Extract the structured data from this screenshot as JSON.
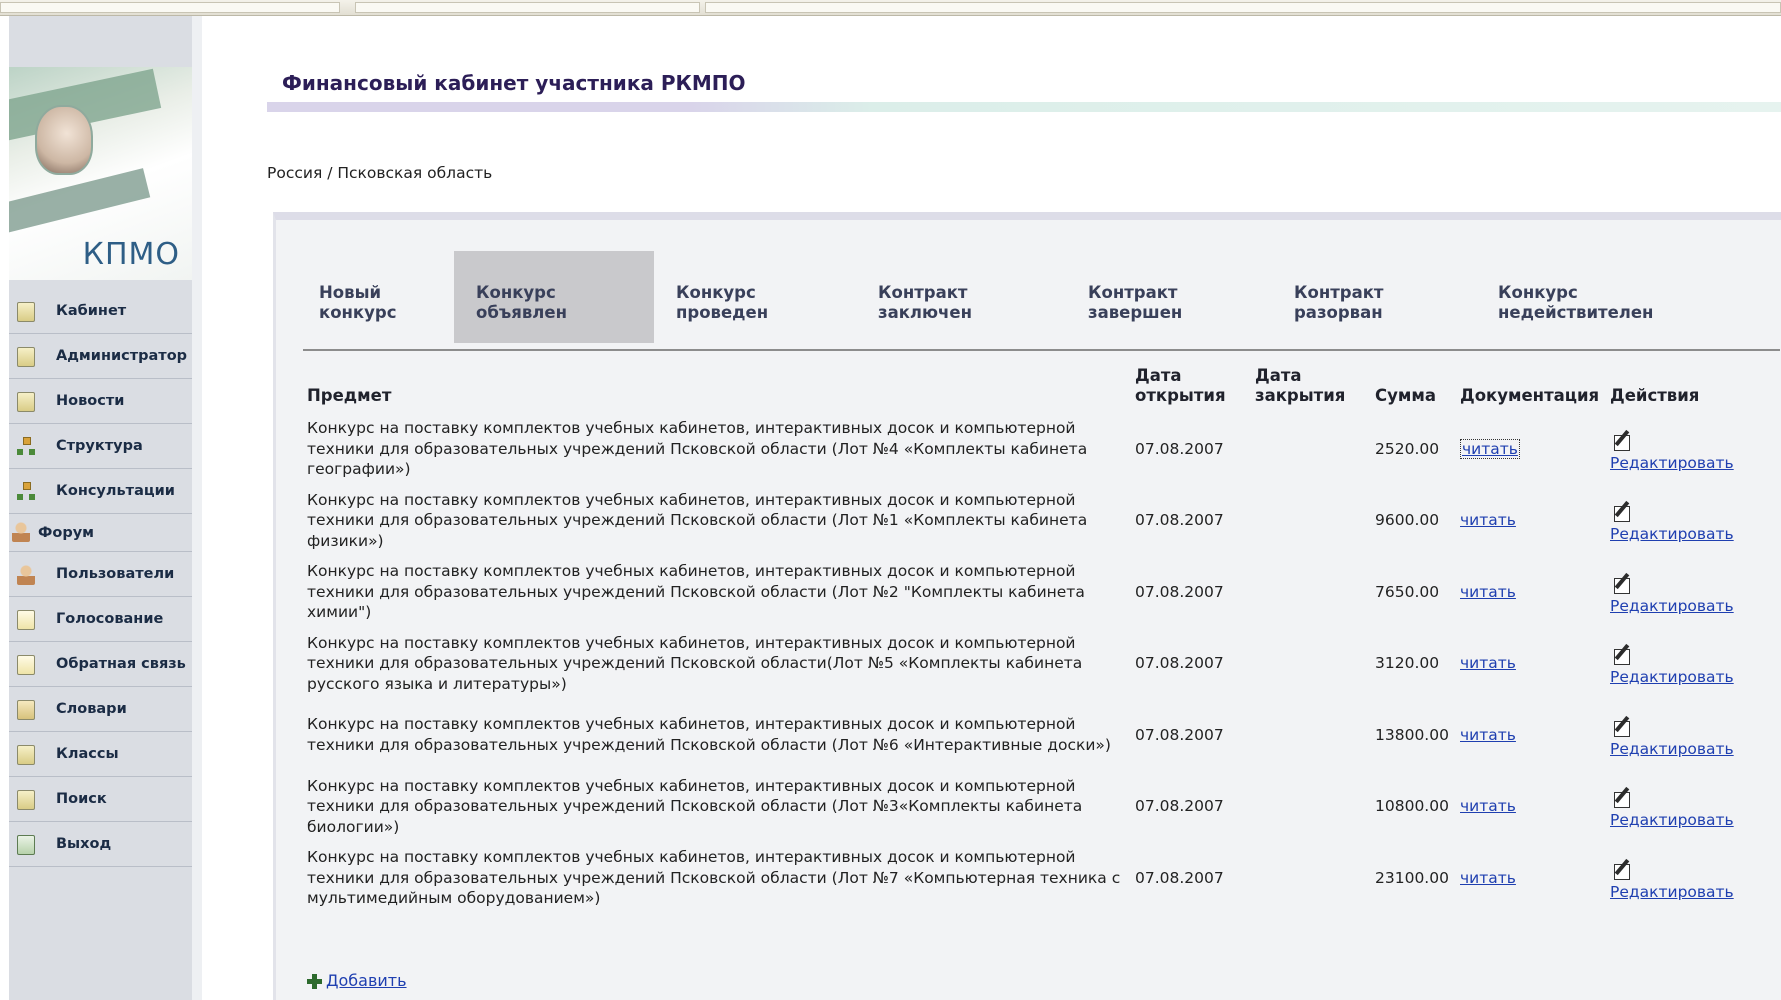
{
  "header": {
    "title": "Финансовый кабинет участника РКМПО",
    "breadcrumb": "Россия / Псковская область"
  },
  "logo": {
    "text": "КПМО"
  },
  "sidebar": {
    "items": [
      {
        "label": "Кабинет",
        "icon": "cabinet-icon"
      },
      {
        "label": "Администратор",
        "icon": "admin-icon"
      },
      {
        "label": "Новости",
        "icon": "news-icon"
      },
      {
        "label": "Структура",
        "icon": "structure-icon"
      },
      {
        "label": "Консультации",
        "icon": "consult-icon"
      },
      {
        "label": "Форум",
        "icon": "forum-icon"
      },
      {
        "label": "Пользователи",
        "icon": "users-icon"
      },
      {
        "label": "Голосование",
        "icon": "vote-icon"
      },
      {
        "label": "Обратная связь",
        "icon": "feedback-icon"
      },
      {
        "label": "Словари",
        "icon": "dictionary-icon"
      },
      {
        "label": "Классы",
        "icon": "classes-icon"
      },
      {
        "label": "Поиск",
        "icon": "search-icon"
      },
      {
        "label": "Выход",
        "icon": "exit-icon"
      }
    ]
  },
  "tabs": [
    {
      "line1": "Новый",
      "line2": "конкурс",
      "active": false
    },
    {
      "line1": "Конкурс",
      "line2": "объявлен",
      "active": true
    },
    {
      "line1": "Конкурс",
      "line2": "проведен",
      "active": false
    },
    {
      "line1": "Контракт",
      "line2": "заключен",
      "active": false
    },
    {
      "line1": "Контракт",
      "line2": "завершен",
      "active": false
    },
    {
      "line1": "Контракт",
      "line2": "разорван",
      "active": false
    },
    {
      "line1": "Конкурс",
      "line2": "недействителен",
      "active": false
    }
  ],
  "table": {
    "headers": {
      "subject": "Предмет",
      "open_date_1": "Дата",
      "open_date_2": "открытия",
      "close_date_1": "Дата",
      "close_date_2": "закрытия",
      "sum": "Сумма",
      "docs": "Документация",
      "actions": "Действия"
    },
    "rows": [
      {
        "subject": "Конкурс на поставку комплектов учебных кабинетов, интерактивных досок и компьютерной техники для образовательных учреждений Псковской области (Лот №4 «Комплекты кабинета географии»)",
        "open_date": "07.08.2007",
        "close_date": "",
        "sum": "2520.00",
        "doc": "читать",
        "action": "Редактировать"
      },
      {
        "subject": "Конкурс на поставку комплектов учебных кабинетов, интерактивных досок и компьютерной техники для образовательных учреждений Псковской области (Лот №1 «Комплекты кабинета физики»)",
        "open_date": "07.08.2007",
        "close_date": "",
        "sum": "9600.00",
        "doc": "читать",
        "action": "Редактировать"
      },
      {
        "subject": "Конкурс на поставку комплектов учебных кабинетов, интерактивных досок и компьютерной техники для образовательных учреждений Псковской области (Лот №2 \"Комплекты кабинета химии\")",
        "open_date": "07.08.2007",
        "close_date": "",
        "sum": "7650.00",
        "doc": "читать",
        "action": "Редактировать"
      },
      {
        "subject": "Конкурс на поставку комплектов учебных кабинетов, интерактивных досок и компьютерной техники для образовательных учреждений Псковской области(Лот №5 «Комплекты кабинета русского языка и литературы»)",
        "open_date": "07.08.2007",
        "close_date": "",
        "sum": "3120.00",
        "doc": "читать",
        "action": "Редактировать"
      },
      {
        "subject": "Конкурс на поставку комплектов учебных кабинетов, интерактивных досок и компьютерной техники для образовательных учреждений Псковской области (Лот №6 «Интерактивные доски»)",
        "open_date": "07.08.2007",
        "close_date": "",
        "sum": "13800.00",
        "doc": "читать",
        "action": "Редактировать"
      },
      {
        "subject": "Конкурс на поставку комплектов учебных кабинетов, интерактивных досок и компьютерной техники для образовательных учреждений Псковской области (Лот №3«Комплекты кабинета биологии»)",
        "open_date": "07.08.2007",
        "close_date": "",
        "sum": "10800.00",
        "doc": "читать",
        "action": "Редактировать"
      },
      {
        "subject": "Конкурс на поставку комплектов учебных кабинетов, интерактивных досок и компьютерной техники для образовательных учреждений Псковской области (Лот №7 «Компьютерная техника с мультимедийным оборудованием»)",
        "open_date": "07.08.2007",
        "close_date": "",
        "sum": "23100.00",
        "doc": "читать",
        "action": "Редактировать"
      }
    ]
  },
  "add_label": "Добавить"
}
